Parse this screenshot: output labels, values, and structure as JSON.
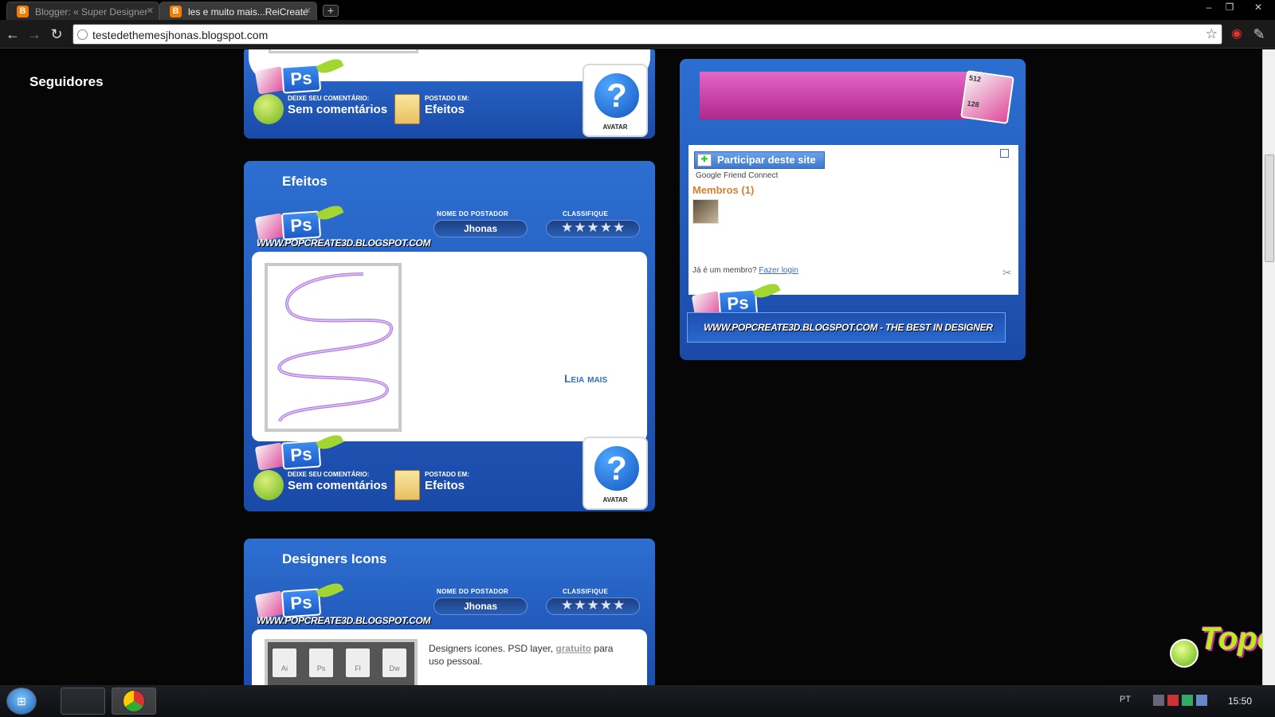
{
  "browser": {
    "tabs": [
      {
        "label": "Blogger: « Super Designer",
        "active": false
      },
      {
        "label": "les e muito mais...ReiCreate",
        "active": true
      }
    ],
    "new_tab_label": "+",
    "url": "testedethemesjhonas.blogspot.com",
    "window_controls": {
      "minimize": "–",
      "maximize": "❐",
      "close": "✕"
    }
  },
  "posts": {
    "post_top_footer": {
      "comment_label": "DEIXE SEU COMENTÁRIO:",
      "comment_value": "Sem comentários",
      "posted_label": "POSTADO EM:",
      "posted_value": "Efeitos",
      "avatar_label": "AVATAR"
    },
    "efeitos": {
      "title": "Efeitos",
      "poster_label": "NOME DO POSTADOR",
      "poster_value": "Jhonas",
      "rate_label": "CLASSIFIQUE",
      "stars": "★★★★★",
      "banner_url": "WWW.POPCREATE3D.BLOGSPOT.COM",
      "read_more": "Leia mais",
      "comment_label": "DEIXE SEU COMENTÁRIO:",
      "comment_value": "Sem comentários",
      "posted_label": "POSTADO EM:",
      "posted_value": "Efeitos",
      "avatar_label": "AVATAR"
    },
    "designers_icons": {
      "title": "Designers Icons",
      "poster_label": "NOME DO POSTADOR",
      "poster_value": "Jhonas",
      "rate_label": "CLASSIFIQUE",
      "stars": "★★★★★",
      "banner_url": "WWW.POPCREATE3D.BLOGSPOT.COM",
      "desc_start": "Designers ícones. PSD layer, ",
      "desc_link": "gratuito",
      "desc_end": " para uso pessoal.",
      "icon_labels": [
        "Ai",
        "Ps",
        "Fl",
        "Dw"
      ]
    }
  },
  "sidebar": {
    "title": "Seguidores",
    "join_button": "Participar deste site",
    "gfc": "Google Friend Connect",
    "members": "Membros (1)",
    "already_member": "Já é um membro?",
    "login_link": "Fazer login",
    "banner": "WWW.POPCREATE3D.BLOGSPOT.COM - THE BEST IN DESIGNER",
    "badge_512": "512",
    "badge_128": "128"
  },
  "topo": "Topo",
  "taskbar": {
    "clock": "15:50",
    "lang": "PT"
  },
  "colors": {
    "blue": "#1f5bbf",
    "pink": "#c73aa5",
    "orange": "#d2802e"
  }
}
